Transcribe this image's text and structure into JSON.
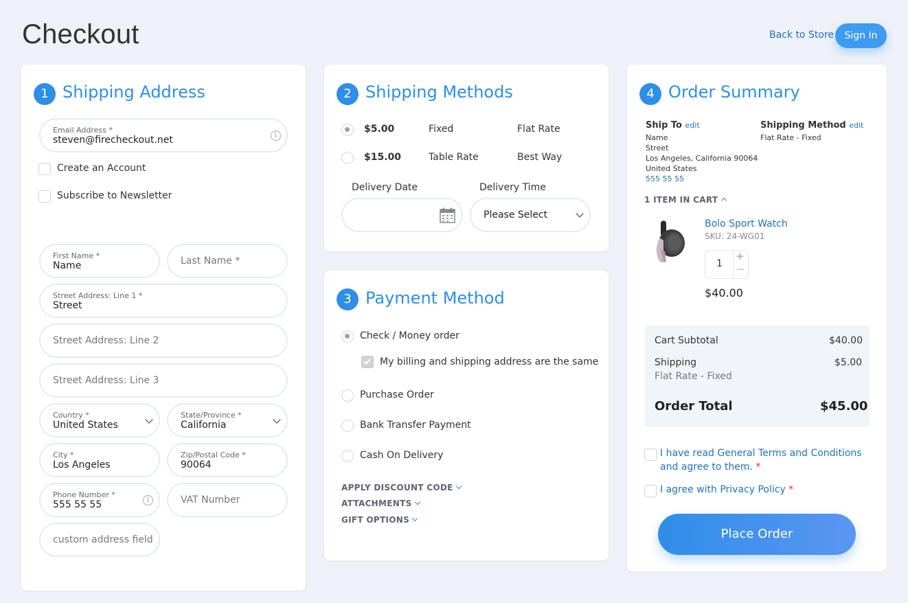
{
  "header": {
    "title": "Checkout",
    "back_link": "Back to Store",
    "signin": "Sign In"
  },
  "shipping_address": {
    "step": "1",
    "title": "Shipping Address",
    "email": {
      "label": "Email Address",
      "required": "*",
      "value": "steven@firecheckout.net"
    },
    "create_account": "Create an Account",
    "newsletter": "Subscribe to Newsletter",
    "first_name": {
      "label": "First Name",
      "required": "*",
      "value": "Name"
    },
    "last_name": {
      "placeholder": "Last Name *"
    },
    "street1": {
      "label": "Street Address: Line 1",
      "required": "*",
      "value": "Street"
    },
    "street2": {
      "placeholder": "Street Address: Line 2"
    },
    "street3": {
      "placeholder": "Street Address: Line 3"
    },
    "country": {
      "label": "Country",
      "required": "*",
      "value": "United States"
    },
    "state": {
      "label": "State/Province",
      "required": "*",
      "value": "California"
    },
    "city": {
      "label": "City",
      "required": "*",
      "value": "Los Angeles"
    },
    "zip": {
      "label": "Zip/Postal Code",
      "required": "*",
      "value": "90064"
    },
    "phone": {
      "label": "Phone Number",
      "required": "*",
      "value": "555 55 55"
    },
    "vat": {
      "placeholder": "VAT Number"
    },
    "custom": {
      "placeholder": "custom address field"
    }
  },
  "shipping_methods": {
    "step": "2",
    "title": "Shipping Methods",
    "options": [
      {
        "price": "$5.00",
        "method": "Fixed",
        "carrier": "Flat Rate",
        "selected": true
      },
      {
        "price": "$15.00",
        "method": "Table Rate",
        "carrier": "Best Way",
        "selected": false
      }
    ],
    "delivery_date_label": "Delivery Date",
    "delivery_time_label": "Delivery Time",
    "delivery_time_value": "Please Select"
  },
  "payment": {
    "step": "3",
    "title": "Payment Method",
    "options": [
      "Check / Money order",
      "Purchase Order",
      "Bank Transfer Payment",
      "Cash On Delivery"
    ],
    "billing_same": "My billing and shipping address are the same",
    "discount": "APPLY DISCOUNT CODE",
    "attachments": "ATTACHMENTS",
    "gift": "GIFT OPTIONS"
  },
  "summary": {
    "step": "4",
    "title": "Order Summary",
    "ship_to_label": "Ship To",
    "edit": "edit",
    "ship_to_lines": [
      "Name",
      "Street",
      "Los Angeles, California 90064",
      "United States"
    ],
    "phone": "555 55 55",
    "shipping_method_label": "Shipping Method",
    "shipping_method_value": "Flat Rate - Fixed",
    "items_in_cart": "1 ITEM IN CART",
    "item": {
      "name": "Bolo Sport Watch",
      "sku": "SKU: 24-WG01",
      "qty": "1",
      "price": "$40.00"
    },
    "subtotal_label": "Cart Subtotal",
    "subtotal": "$40.00",
    "shipping_label": "Shipping",
    "shipping_sub": "Flat Rate - Fixed",
    "shipping": "$5.00",
    "total_label": "Order Total",
    "total": "$45.00",
    "terms_line1": "I have read General Terms and Conditions",
    "terms_line2": "and agree to them.",
    "privacy": "I agree with Privacy Policy",
    "required": "*",
    "place_order": "Place Order"
  },
  "colors": {
    "accent": "#2f8ee8",
    "link": "#1f72b8",
    "background": "#eef1f7",
    "required": "#e02b27"
  }
}
